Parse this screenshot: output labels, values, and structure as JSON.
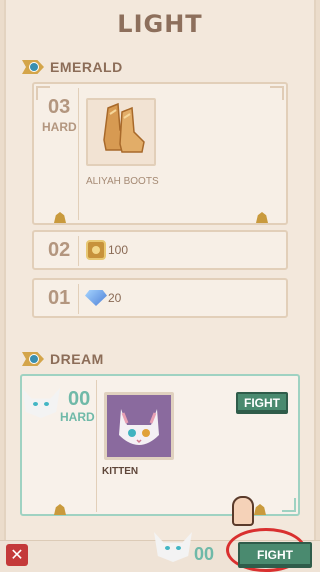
{
  "page": {
    "title": "LIGHT"
  },
  "sections": {
    "emerald": {
      "label": "EMERALD",
      "tiers": [
        {
          "number": "03",
          "difficulty": "HARD",
          "reward_name": "ALIYAH BOOTS",
          "reward_icon": "boots-icon"
        },
        {
          "number": "02",
          "reward_value": "100",
          "reward_icon": "coin-icon"
        },
        {
          "number": "01",
          "reward_value": "20",
          "reward_icon": "diamond-icon"
        }
      ]
    },
    "dream": {
      "label": "DREAM",
      "tier": {
        "number": "00",
        "difficulty": "HARD",
        "reward_name": "KITTEN",
        "reward_icon": "kitten-icon",
        "fight_label": "FIGHT"
      }
    }
  },
  "bottom_bar": {
    "close_icon": "close-icon",
    "level": "00",
    "fight_label": "FIGHT"
  },
  "colors": {
    "accent_teal": "#6fb9a8",
    "fight_button": "#4a8a6f",
    "close_red": "#c43a3a",
    "highlight_ring": "#d9302f"
  }
}
